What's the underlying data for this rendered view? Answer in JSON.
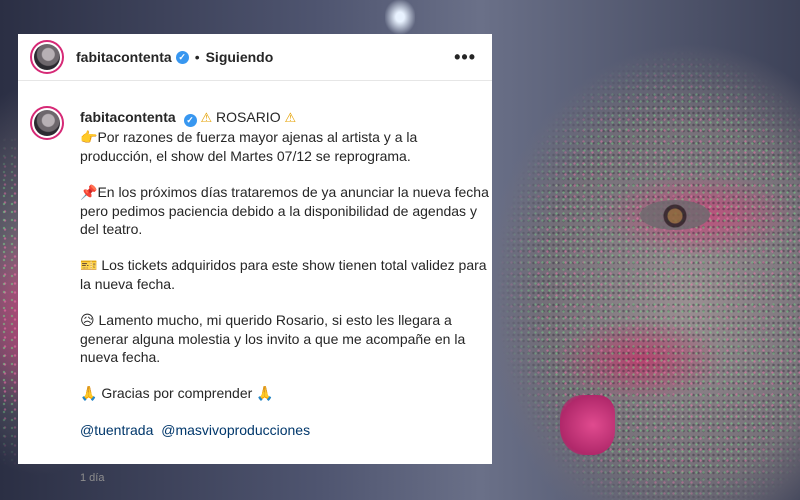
{
  "post": {
    "username": "fabitacontenta",
    "separator": "•",
    "following_label": "Siguiendo",
    "more_label": "•••"
  },
  "caption": {
    "username": "fabitacontenta",
    "title": "ROSARIO",
    "warn_icon": "⚠",
    "line1_icon": "👉",
    "line1": "Por razones de fuerza mayor ajenas al artista y a la producción, el show del Martes 07/12 se reprograma.",
    "line2_icon": "📌",
    "line2": "En los próximos días trataremos de ya anunciar la nueva fecha pero pedimos paciencia debido a la disponibilidad de agendas y del teatro.",
    "line3_icon": "🎫",
    "line3": "Los tickets adquiridos para este show tienen total validez para la nueva fecha.",
    "line4_icon": "😥",
    "line4": "Lamento mucho, mi querido Rosario, si esto les llegara a generar alguna molestia y los invito a que me acompañe en la nueva fecha.",
    "thanks_icon": "🙏",
    "thanks": "Gracias por comprender",
    "mentions": [
      "@tuentrada",
      "@masvivoproducciones"
    ],
    "time": "1 día"
  },
  "colors": {
    "accent_link": "#00376b",
    "verified": "#3897f0",
    "warning": "#e5a000"
  }
}
